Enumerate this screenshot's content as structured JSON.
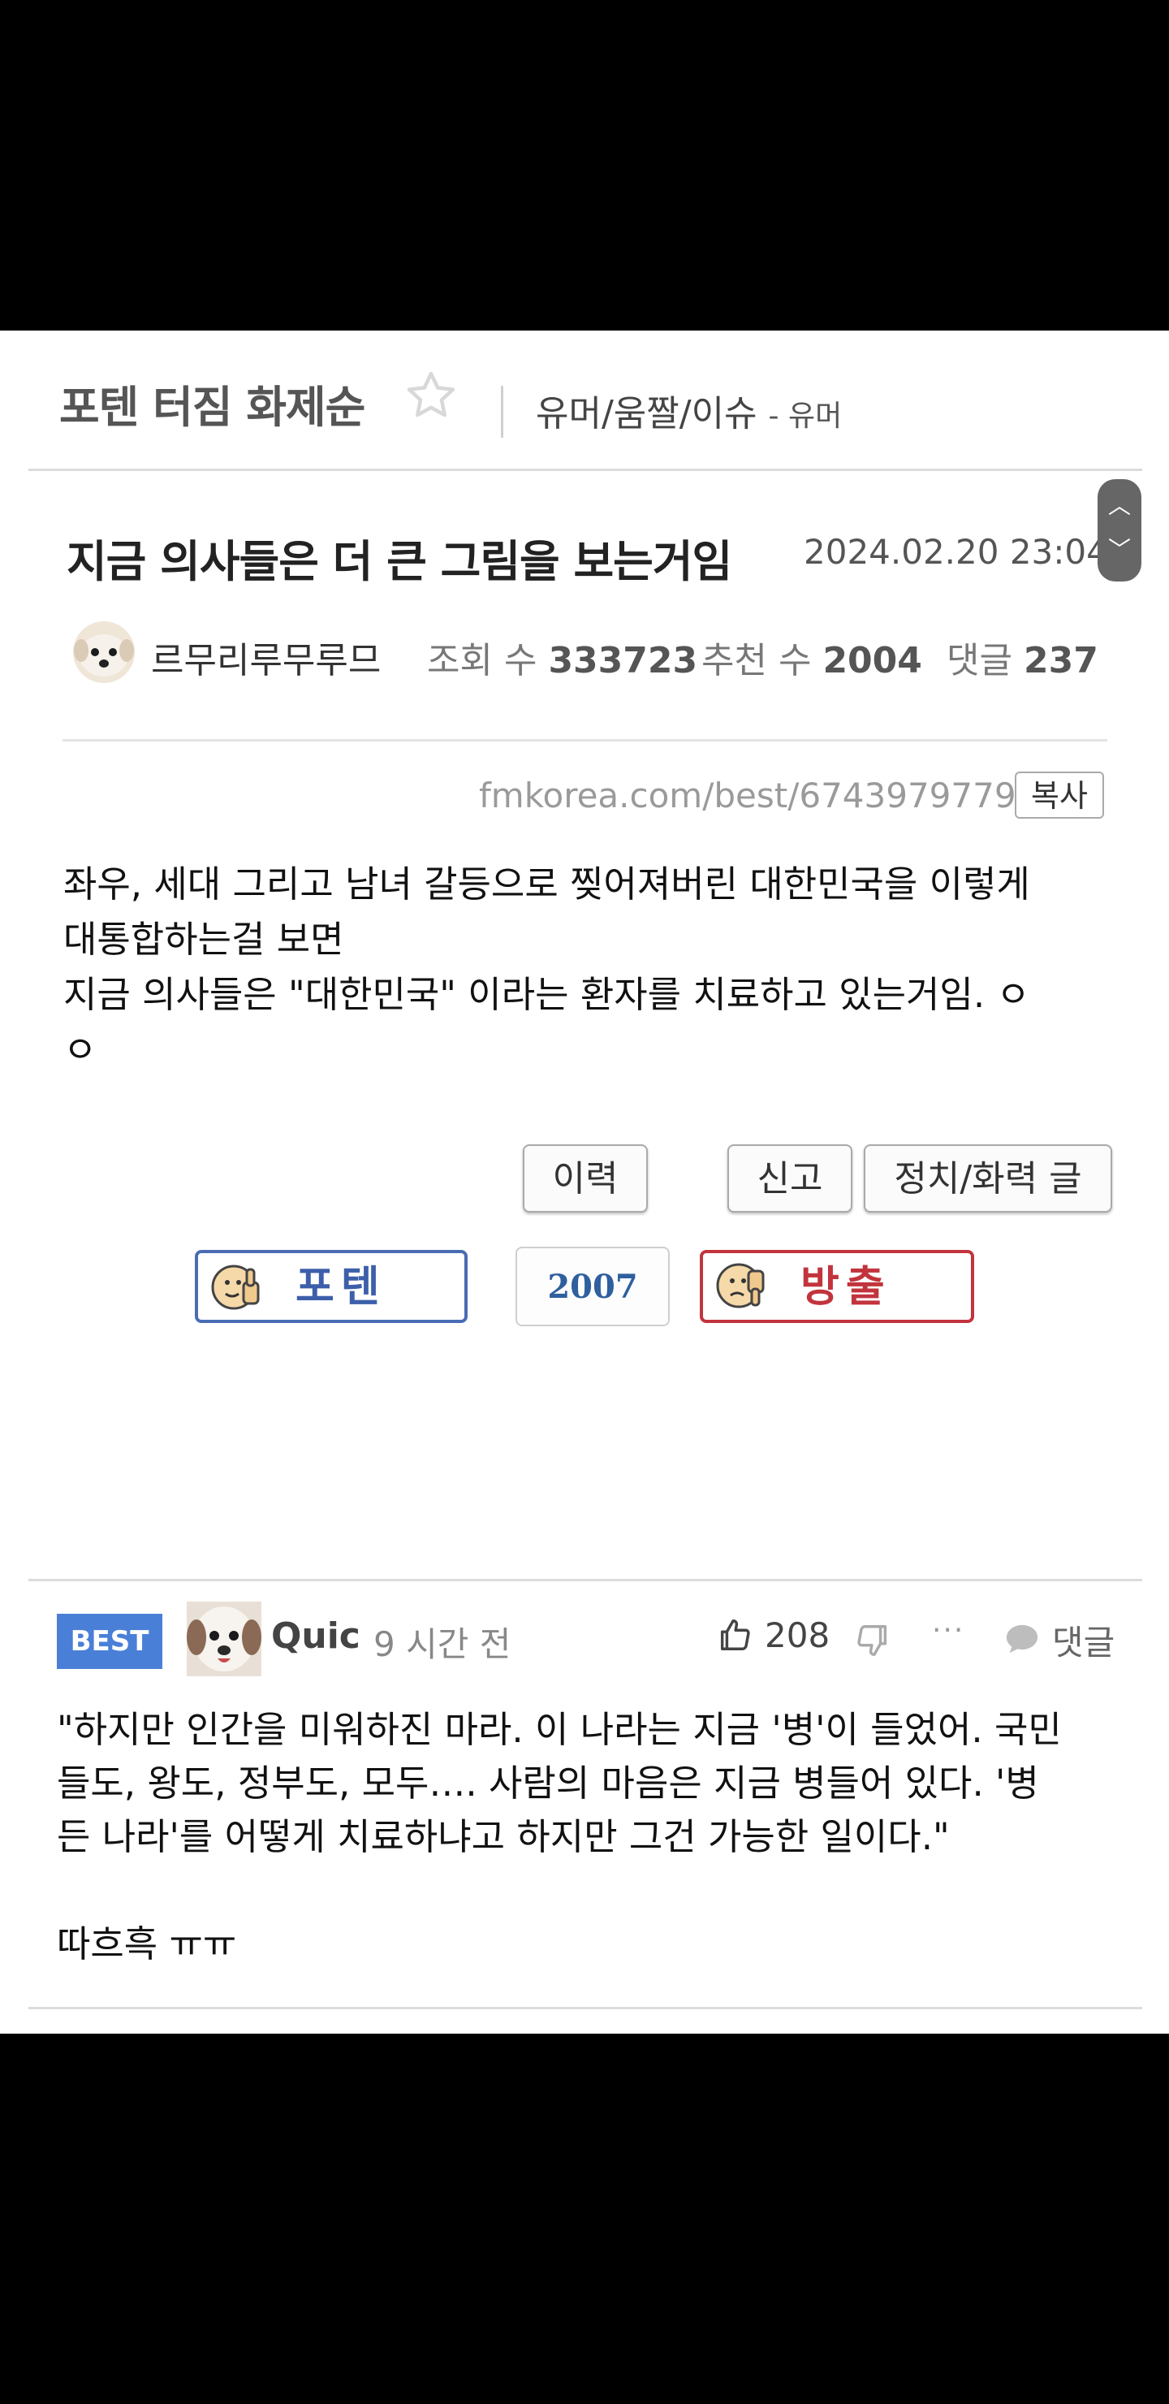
{
  "board": {
    "title": "포텐 터짐 화제순",
    "breadcrumb_main": "유머/움짤/이슈",
    "breadcrumb_sub": "- 유머"
  },
  "post": {
    "title": "지금 의사들은 더 큰 그림을 보는거임",
    "date": "2024.02.20 23:04",
    "author": "르무리루무루므",
    "views_label": "조회 수",
    "views": "333723",
    "recommend_label": "추천 수",
    "recommend": "2004",
    "comments_label": "댓글",
    "comments": "237",
    "url": "fmkorea.com/best/6743979779",
    "copy_label": "복사",
    "body_lines": [
      "좌우, 세대 그리고 남녀 갈등으로 찢어져버린 대한민국을 이렇게",
      "대통합하는걸 보면",
      "지금 의사들은 \"대한민국\" 이라는 환자를 치료하고 있는거임. ㅇ",
      "ㅇ"
    ],
    "buttons": {
      "history": "이력",
      "report": "신고",
      "politics": "정치/화력 글"
    },
    "vote": {
      "up_label": "포텐",
      "count": "2007",
      "down_label": "방출"
    }
  },
  "scroll": {
    "up_icon": "chevron-up",
    "down_icon": "chevron-down"
  },
  "comment": {
    "badge": "BEST",
    "author": "Quic",
    "time": "9 시간 전",
    "likes": "208",
    "reply_label": "댓글",
    "more": "···",
    "lines": [
      "\"하지만 인간을 미워하진 마라. 이 나라는 지금 '병'이 들었어. 국민",
      "들도, 왕도, 정부도, 모두…. 사람의 마음은 지금 병들어 있다. '병",
      "든 나라'를 어떻게 치료하냐고 하지만 그건 가능한 일이다.\"",
      "",
      "따흐흑 ㅠㅠ"
    ]
  },
  "colors": {
    "best_badge": "#4a7fd8",
    "vote_up": "#3d5faa",
    "vote_down": "#c2343d",
    "count": "#2f5f9e"
  }
}
